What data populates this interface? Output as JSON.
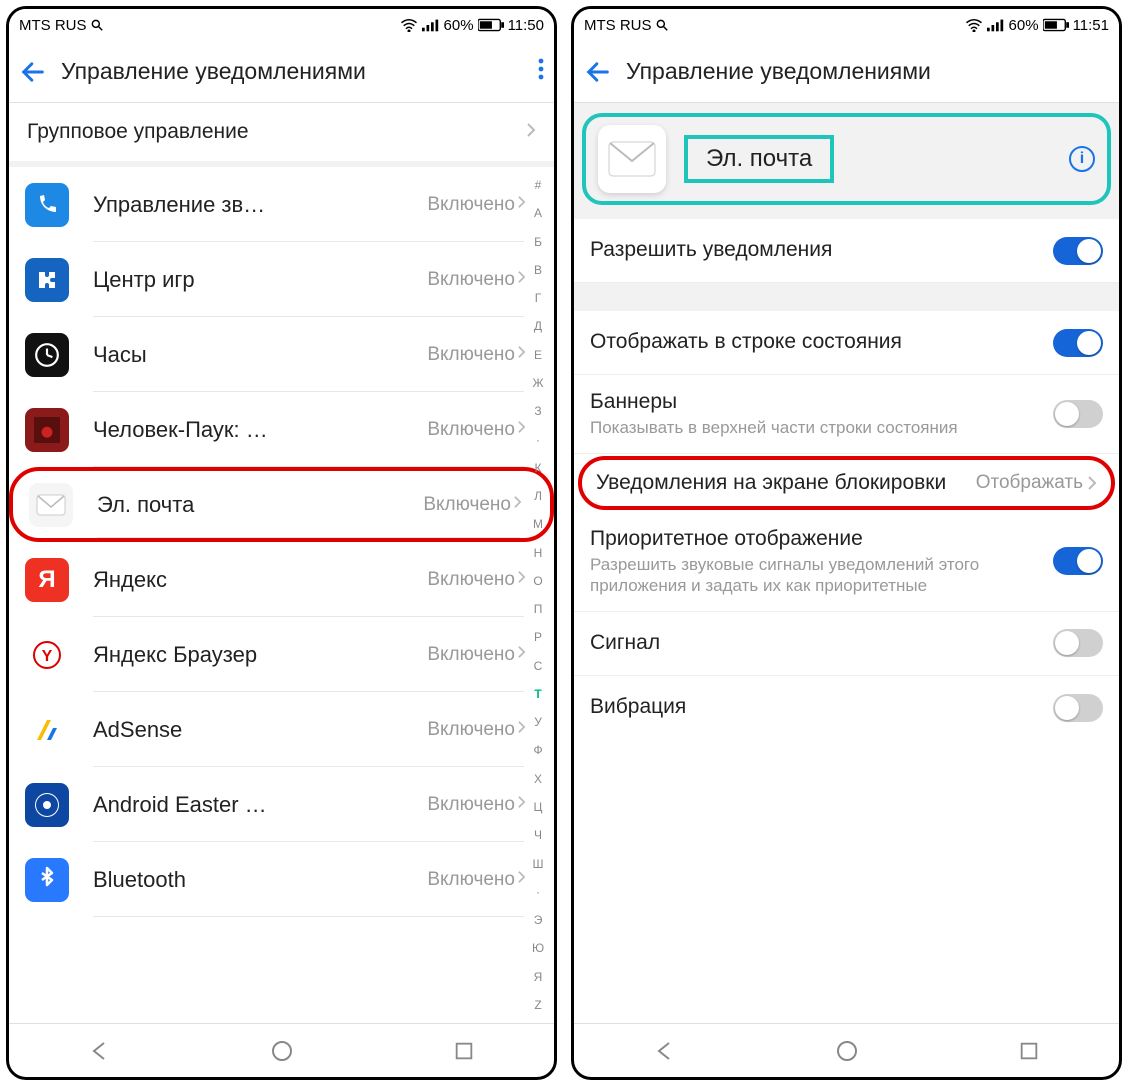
{
  "status": {
    "carrier": "MTS RUS",
    "battery": "60%",
    "time_left": "11:50",
    "time_right": "11:51"
  },
  "header": {
    "title": "Управление уведомлениями"
  },
  "group_mgmt": "Групповое управление",
  "apps": [
    {
      "name": "Управление зв…",
      "status": "Включено",
      "icon_bg": "#1e88e5",
      "glyph": "phone"
    },
    {
      "name": "Центр игр",
      "status": "Включено",
      "icon_bg": "#1565c0",
      "glyph": "puzzle"
    },
    {
      "name": "Часы",
      "status": "Включено",
      "icon_bg": "#111",
      "glyph": "clock"
    },
    {
      "name": "Человек-Паук: …",
      "status": "Включено",
      "icon_bg": "#8b1a1a",
      "glyph": "spider"
    },
    {
      "name": "Эл. почта",
      "status": "Включено",
      "icon_bg": "#f5f5f5",
      "glyph": "mail",
      "highlight": true
    },
    {
      "name": "Яндекс",
      "status": "Включено",
      "icon_bg": "#ef3124",
      "glyph": "ya"
    },
    {
      "name": "Яндекс Браузер",
      "status": "Включено",
      "icon_bg": "#ffffff",
      "glyph": "ybrowser"
    },
    {
      "name": "AdSense",
      "status": "Включено",
      "icon_bg": "#ffffff",
      "glyph": "adsense"
    },
    {
      "name": "Android Easter …",
      "status": "Включено",
      "icon_bg": "#0d47a1",
      "glyph": "donut"
    },
    {
      "name": "Bluetooth",
      "status": "Включено",
      "icon_bg": "#2979ff",
      "glyph": "bt"
    }
  ],
  "alpha_index": [
    "#",
    "А",
    "Б",
    "В",
    "Г",
    "Д",
    "Е",
    "Ж",
    "З",
    "·",
    "К",
    "Л",
    "М",
    "Н",
    "О",
    "П",
    "Р",
    "С",
    "Т",
    "У",
    "Ф",
    "Х",
    "Ц",
    "Ч",
    "Ш",
    "·",
    "Э",
    "Ю",
    "Я",
    "Z"
  ],
  "alpha_active": "Т",
  "right": {
    "app_name": "Эл. почта",
    "allow": {
      "title": "Разрешить уведомления",
      "on": true
    },
    "status_bar": {
      "title": "Отображать в строке состояния",
      "on": true
    },
    "banners": {
      "title": "Баннеры",
      "sub": "Показывать в верхней части строки состояния",
      "on": false
    },
    "lockscreen": {
      "title": "Уведомления на экране блокировки",
      "value": "Отображать"
    },
    "priority": {
      "title": "Приоритетное отображение",
      "sub": "Разрешить звуковые сигналы уведомлений этого приложения и задать их как приоритетные",
      "on": true
    },
    "sound": {
      "title": "Сигнал",
      "on": false
    },
    "vibration": {
      "title": "Вибрация",
      "on": false
    }
  }
}
